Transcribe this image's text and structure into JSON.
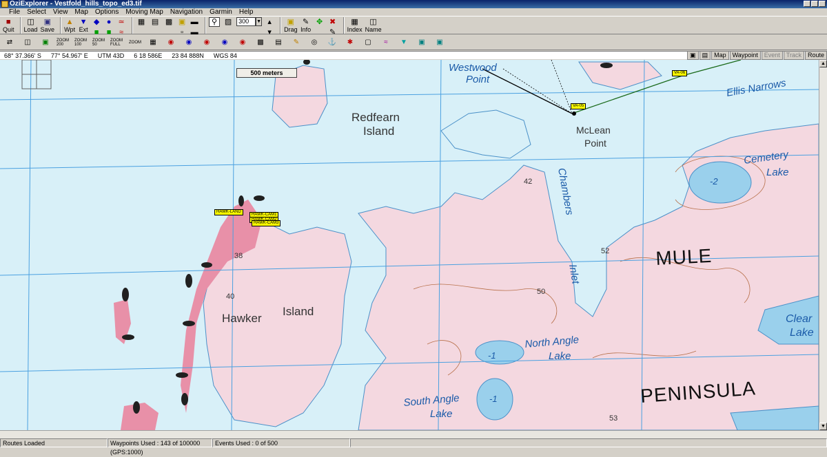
{
  "window": {
    "title": "OziExplorer - Vestfold_hills_topo_ed3.tif"
  },
  "menu": [
    "File",
    "Select",
    "View",
    "Map",
    "Options",
    "Moving Map",
    "Navigation",
    "Garmin",
    "Help"
  ],
  "toolbar": {
    "quit": "Quit",
    "load": "Load",
    "save": "Save",
    "wpt": "Wpt",
    "ext": "Ext",
    "drag": "Drag",
    "info": "Info",
    "index": "Index",
    "name": "Name",
    "zoom_value": "300"
  },
  "toolbar2": {
    "zoom200": "ZOOM 200",
    "zoom100": "ZOOM 100",
    "zoom50": "ZOOM 50",
    "zoomfull": "ZOOM FULL",
    "zoom": "ZOOM"
  },
  "coords": {
    "lat": "68° 37.366' S",
    "lon": "77° 54.967' E",
    "utm": "UTM  43D",
    "easting": "6 18 586E",
    "northing": "23 84 888N",
    "datum": "WGS 84"
  },
  "right_tabs": {
    "map": "Map",
    "waypoint": "Waypoint",
    "event": "Event",
    "track": "Track",
    "route": "Route"
  },
  "map": {
    "scale": "500 meters",
    "labels": {
      "westwood": "Westwood",
      "point1": "Point",
      "redfearn1": "Redfearn",
      "redfearn2": "Island",
      "mclean1": "McLean",
      "mclean2": "Point",
      "ellis": "Ellis Narrows",
      "cemetery1": "Cemetery",
      "cemetery2": "Lake",
      "chambers": "Chambers",
      "inlet": "Inlet",
      "mule": "MULE",
      "peninsula": "PENINSULA",
      "hawker1": "Hawker",
      "hawker2": "Island",
      "clear1": "Clear",
      "clear2": "Lake",
      "nal1": "North Angle",
      "nal2": "Lake",
      "sal1": "South Angle",
      "sal2": "Lake",
      "h42": "42",
      "h38": "38",
      "h40": "40",
      "h50": "50",
      "h52": "52",
      "h53": "53",
      "d2": "-2",
      "d1a": "-1",
      "d1b": "-1"
    },
    "waypoints": {
      "hawk_land": "HAWK-LAND",
      "hawk_cam1": "HAWK-CAM1",
      "hawk_cam2": "HAWK-CAM2",
      "hawk_cam3": "HAWK-CAM3",
      "va05": "VA-05",
      "va06": "VA-06"
    }
  },
  "status": {
    "routes": "Routes Loaded",
    "waypoints": "Waypoints Used : 143 of 100000  (GPS:1000)",
    "events": "Events Used : 0 of 500"
  }
}
